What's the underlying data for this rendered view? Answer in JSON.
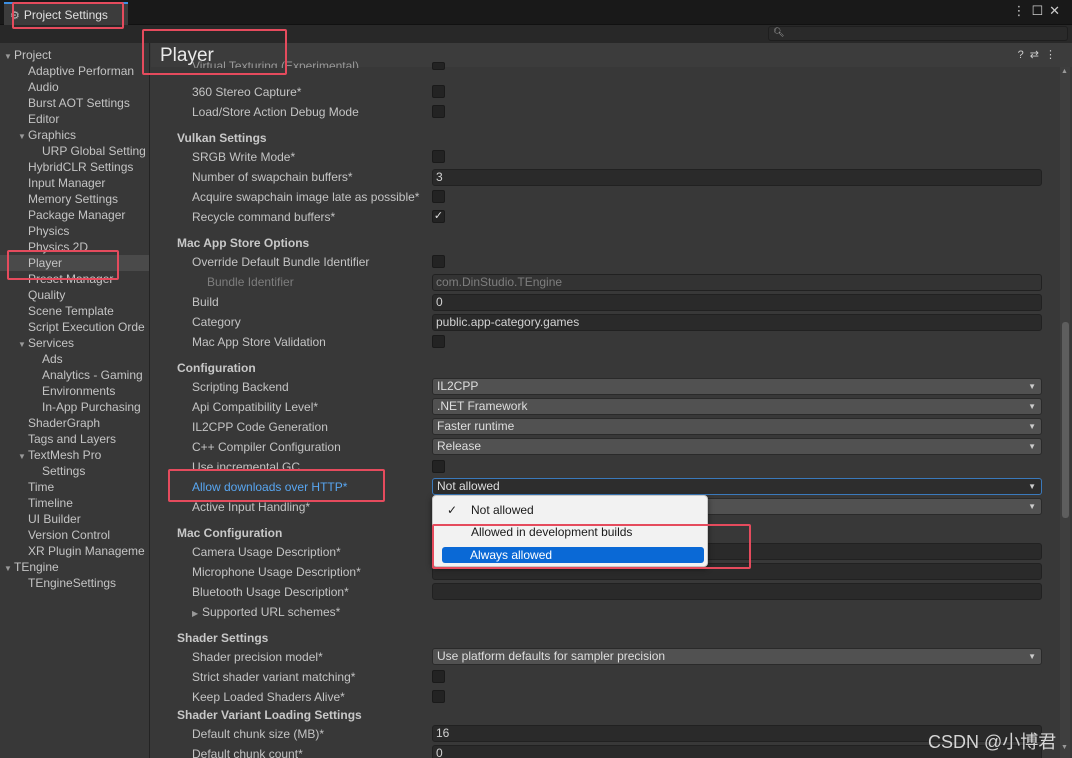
{
  "window": {
    "tab_title": "Project Settings",
    "menu_icon": "kebab-icon",
    "maximize_icon": "maximize-icon",
    "close_icon": "close-icon"
  },
  "search": {
    "placeholder": "",
    "icon": "search-icon"
  },
  "sidebar": {
    "items": [
      {
        "label": "Project",
        "level": 0,
        "expanded": true
      },
      {
        "label": "Adaptive Performan",
        "level": 1
      },
      {
        "label": "Audio",
        "level": 1
      },
      {
        "label": "Burst AOT Settings",
        "level": 1
      },
      {
        "label": "Editor",
        "level": 1
      },
      {
        "label": "Graphics",
        "level": 1,
        "expanded": true
      },
      {
        "label": "URP Global Setting",
        "level": 2
      },
      {
        "label": "HybridCLR Settings",
        "level": 1
      },
      {
        "label": "Input Manager",
        "level": 1
      },
      {
        "label": "Memory Settings",
        "level": 1
      },
      {
        "label": "Package Manager",
        "level": 1
      },
      {
        "label": "Physics",
        "level": 1
      },
      {
        "label": "Physics 2D",
        "level": 1
      },
      {
        "label": "Player",
        "level": 1,
        "selected": true
      },
      {
        "label": "Preset Manager",
        "level": 1
      },
      {
        "label": "Quality",
        "level": 1
      },
      {
        "label": "Scene Template",
        "level": 1
      },
      {
        "label": "Script Execution Orde",
        "level": 1
      },
      {
        "label": "Services",
        "level": 1,
        "expanded": true
      },
      {
        "label": "Ads",
        "level": 2
      },
      {
        "label": "Analytics - Gaming",
        "level": 2
      },
      {
        "label": "Environments",
        "level": 2
      },
      {
        "label": "In-App Purchasing",
        "level": 2
      },
      {
        "label": "ShaderGraph",
        "level": 1
      },
      {
        "label": "Tags and Layers",
        "level": 1
      },
      {
        "label": "TextMesh Pro",
        "level": 1,
        "expanded": true
      },
      {
        "label": "Settings",
        "level": 2
      },
      {
        "label": "Time",
        "level": 1
      },
      {
        "label": "Timeline",
        "level": 1
      },
      {
        "label": "UI Builder",
        "level": 1
      },
      {
        "label": "Version Control",
        "level": 1
      },
      {
        "label": "XR Plugin Manageme",
        "level": 1
      },
      {
        "label": "TEngine",
        "level": 0,
        "expanded": true
      },
      {
        "label": "TEngineSettings",
        "level": 1
      }
    ]
  },
  "main": {
    "title": "Player",
    "header_icons": [
      "help-icon",
      "presets-icon",
      "kebab-icon"
    ],
    "clipped_top_label": "Virtual Texturing (Experimental)",
    "rows": {
      "stereo": "360 Stereo Capture*",
      "loadstore": "Load/Store Action Debug Mode",
      "vulkan": "Vulkan Settings",
      "srgb": "SRGB Write Mode*",
      "swap_buffers": "Number of swapchain buffers*",
      "swap_buffers_val": "3",
      "acquire_late": "Acquire swapchain image late as possible*",
      "recycle": "Recycle command buffers*",
      "mac_store": "Mac App Store Options",
      "override_bundle": "Override Default Bundle Identifier",
      "bundle_id": "Bundle Identifier",
      "bundle_id_val": "com.DinStudio.TEngine",
      "build": "Build",
      "build_val": "0",
      "category": "Category",
      "category_val": "public.app-category.games",
      "store_validation": "Mac App Store Validation",
      "configuration": "Configuration",
      "scripting_backend": "Scripting Backend",
      "scripting_backend_val": "IL2CPP",
      "api_level": "Api Compatibility Level*",
      "api_level_val": ".NET Framework",
      "il2cpp_gen": "IL2CPP Code Generation",
      "il2cpp_gen_val": "Faster runtime",
      "cpp_config": "C++ Compiler Configuration",
      "cpp_config_val": "Release",
      "incremental_gc": "Use incremental GC",
      "http": "Allow downloads over HTTP*",
      "http_val": "Not allowed",
      "input_handling": "Active Input Handling*",
      "mac_config": "Mac Configuration",
      "camera_desc": "Camera Usage Description*",
      "mic_desc": "Microphone Usage Description*",
      "bt_desc": "Bluetooth Usage Description*",
      "url_schemes": "Supported URL schemes*",
      "shader_settings": "Shader Settings",
      "shader_precision": "Shader precision model*",
      "shader_precision_val": "Use platform defaults for sampler precision",
      "strict_variant": "Strict shader variant matching*",
      "keep_shaders": "Keep Loaded Shaders Alive*",
      "variant_loading": "Shader Variant Loading Settings",
      "chunk_size": "Default chunk size (MB)*",
      "chunk_size_val": "16",
      "chunk_count": "Default chunk count*",
      "chunk_count_val": "0"
    }
  },
  "popup": {
    "options": [
      "Not allowed",
      "Allowed in development builds",
      "Always allowed"
    ],
    "checked": "Not allowed",
    "highlighted": "Always allowed"
  },
  "watermark": "CSDN @小博君",
  "colors": {
    "accent": "#3c8fe2",
    "highlight": "#0a69d6",
    "annotation": "#e54b5d",
    "link": "#58a6f1"
  }
}
